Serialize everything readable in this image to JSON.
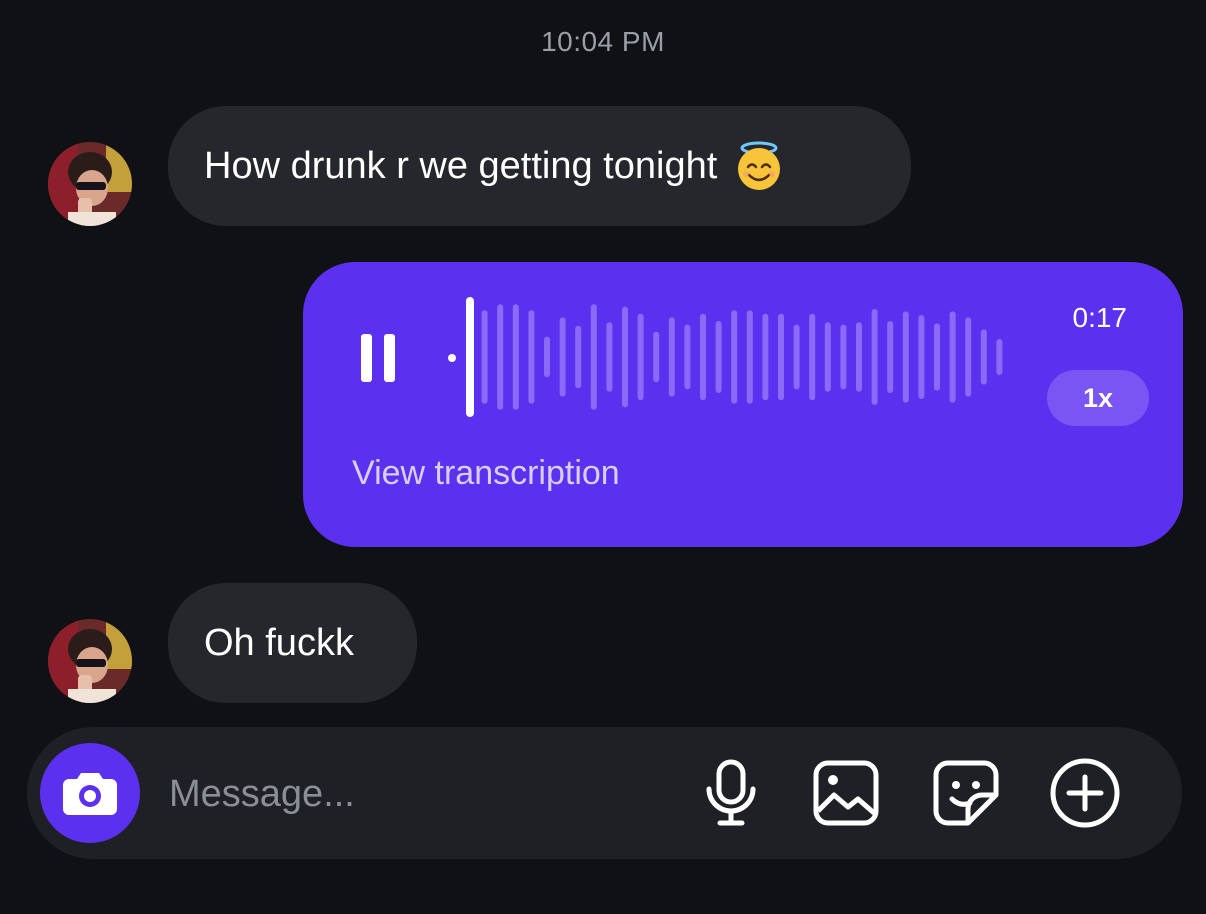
{
  "thread": {
    "timestamp": "10:04 PM",
    "messages": [
      {
        "direction": "incoming",
        "type": "text",
        "text": "How drunk r we getting tonight",
        "emoji": "smiling-face-with-halo"
      },
      {
        "direction": "outgoing",
        "type": "voice",
        "duration": "0:17",
        "speed": "1x",
        "transcription_label": "View transcription",
        "state": "playing",
        "progress": 0.03
      },
      {
        "direction": "incoming",
        "type": "text",
        "text": "Oh fuckk"
      }
    ]
  },
  "composer": {
    "placeholder": "Message...",
    "icons": [
      "camera-icon",
      "microphone-icon",
      "image-icon",
      "sticker-icon",
      "plus-circle-icon"
    ]
  },
  "colors": {
    "background": "#0f1115",
    "incoming_bubble": "#25272c",
    "outgoing_bubble": "#5b30ef",
    "accent": "#5b30ef"
  },
  "waveform_levels": [
    1.0,
    0.78,
    0.88,
    0.88,
    0.78,
    0.34,
    0.66,
    0.52,
    0.88,
    0.58,
    0.84,
    0.72,
    0.42,
    0.66,
    0.54,
    0.72,
    0.6,
    0.78,
    0.78,
    0.72,
    0.72,
    0.54,
    0.72,
    0.58,
    0.54,
    0.58,
    0.8,
    0.6,
    0.76,
    0.7,
    0.56,
    0.76,
    0.66,
    0.46,
    0.3
  ]
}
